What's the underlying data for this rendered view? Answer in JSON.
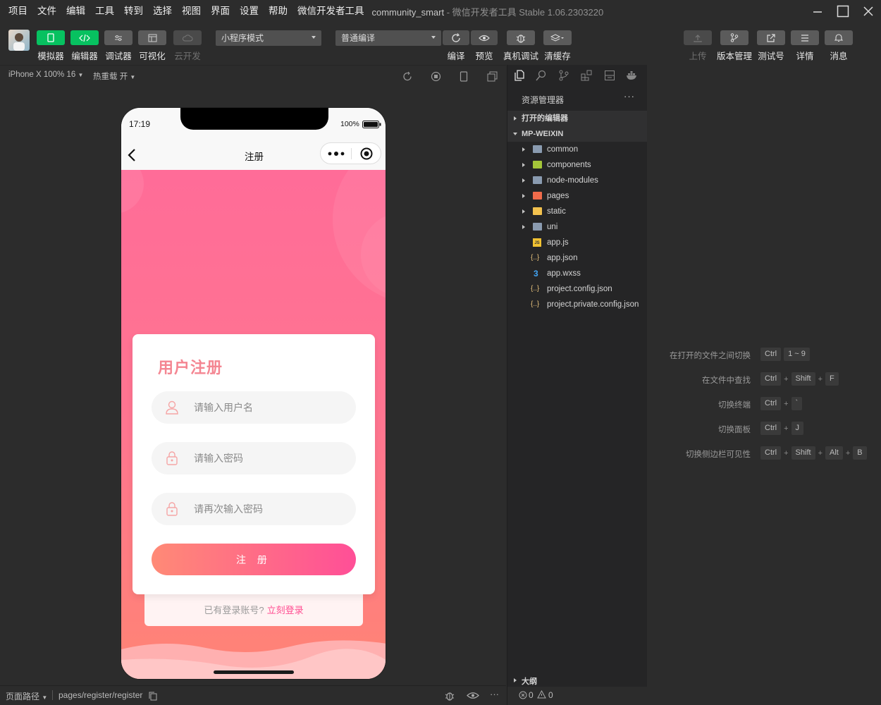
{
  "menubar": {
    "items": [
      "项目",
      "文件",
      "编辑",
      "工具",
      "转到",
      "选择",
      "视图",
      "界面",
      "设置",
      "帮助",
      "微信开发者工具"
    ],
    "title": "community_smart",
    "app_version": "- 微信开发者工具 Stable 1.06.2303220"
  },
  "toolbar": {
    "simulator_label": "模拟器",
    "editor_label": "编辑器",
    "debugger_label": "调试器",
    "visual_label": "可视化",
    "cloud_label": "云开发",
    "mode_select": "小程序模式",
    "compile_select": "普通编译",
    "compile_label": "编译",
    "preview_label": "预览",
    "remote_debug_label": "真机调试",
    "clear_cache_label": "清缓存",
    "upload_label": "上传",
    "version_label": "版本管理",
    "test_label": "测试号",
    "details_label": "详情",
    "messages_label": "消息"
  },
  "simbar": {
    "device": "iPhone X 100% 16",
    "hot_reload": "热重载 开"
  },
  "phone": {
    "time": "17:19",
    "battery": "100%",
    "nav_title": "注册",
    "card_title": "用户注册",
    "username_placeholder": "请输入用户名",
    "password_placeholder": "请输入密码",
    "password2_placeholder": "请再次输入密码",
    "register_button": "注 册",
    "have_account": "已有登录账号?",
    "login_link": "立刻登录"
  },
  "explorer": {
    "header": "资源管理器",
    "more": "···",
    "open_editors": "打开的编辑器",
    "project": "MP-WEIXIN",
    "folders": [
      {
        "name": "common",
        "color": "#8a9bb0"
      },
      {
        "name": "components",
        "color": "#a4c639"
      },
      {
        "name": "node-modules",
        "color": "#8a9bb0"
      },
      {
        "name": "pages",
        "color": "#f06b4b"
      },
      {
        "name": "static",
        "color": "#f2c14e"
      },
      {
        "name": "uni",
        "color": "#8a9bb0"
      }
    ],
    "files": [
      {
        "name": "app.js",
        "icon": "JS"
      },
      {
        "name": "app.json",
        "icon": "{..}"
      },
      {
        "name": "app.wxss",
        "icon": "3"
      },
      {
        "name": "project.config.json",
        "icon": "{..}"
      },
      {
        "name": "project.private.config.json",
        "icon": "{..}"
      }
    ],
    "outline": "大纲"
  },
  "shortcuts": [
    {
      "label": "在打开的文件之间切换",
      "keys": [
        "Ctrl",
        "1 ~ 9"
      ]
    },
    {
      "label": "在文件中查找",
      "keys": [
        "Ctrl",
        "Shift",
        "F"
      ]
    },
    {
      "label": "切换终端",
      "keys": [
        "Ctrl",
        "`"
      ]
    },
    {
      "label": "切换面板",
      "keys": [
        "Ctrl",
        "J"
      ]
    },
    {
      "label": "切换侧边栏可见性",
      "keys": [
        "Ctrl",
        "Shift",
        "Alt",
        "B"
      ]
    }
  ],
  "bottombar": {
    "page_path_label": "页面路径",
    "page_path": "pages/register/register",
    "more": "···",
    "errors": "0",
    "warnings": "0"
  },
  "colors": {
    "accent_green": "#07c160",
    "pink_title": "#f48692",
    "login_link": "#ff4d91",
    "button_from": "#ff8a76",
    "button_to": "#ff4f97"
  }
}
